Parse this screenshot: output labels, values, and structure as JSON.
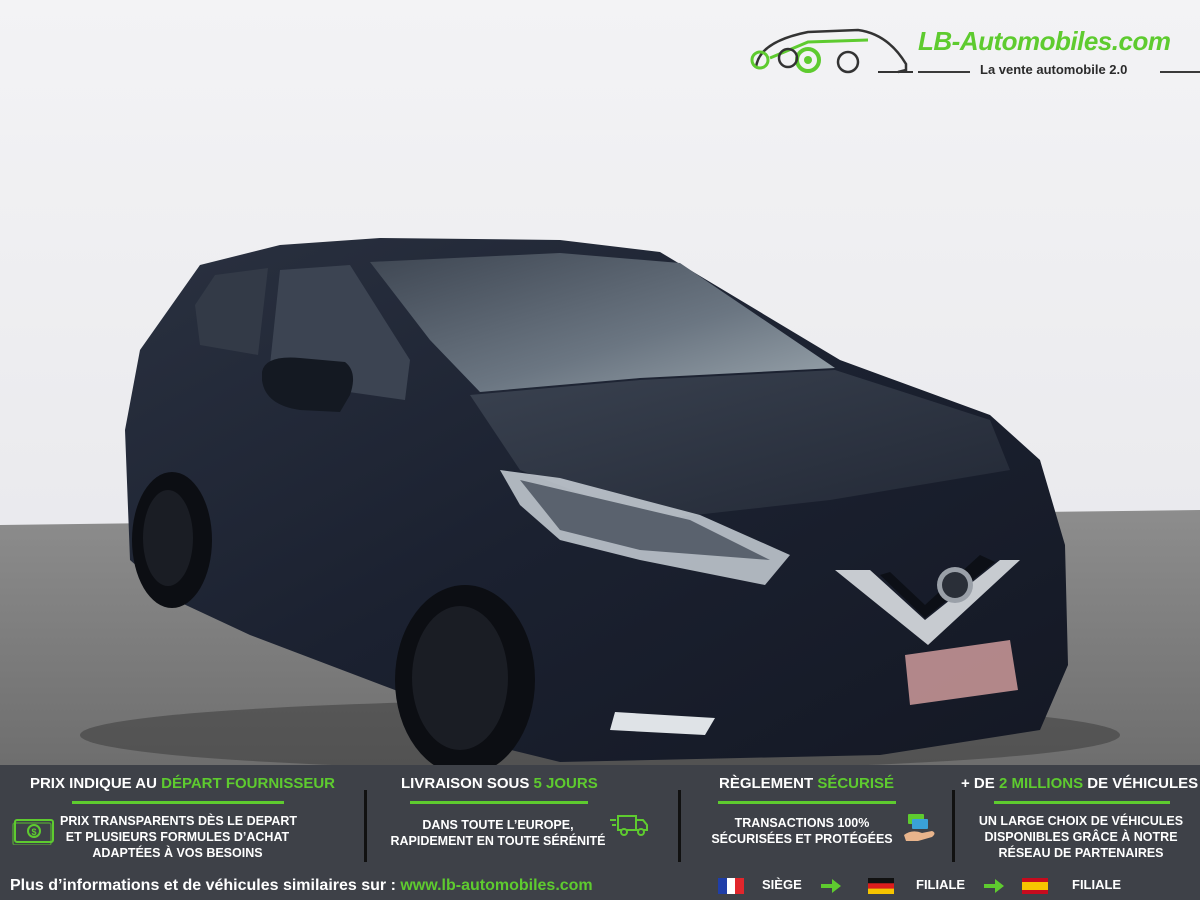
{
  "logo": {
    "name": "LB-Automobiles.com",
    "tagline": "La vente automobile 2.0"
  },
  "photo": {
    "subject": "car-photo"
  },
  "features": [
    {
      "title_plain": "PRIX INDIQUE AU ",
      "title_accent": "DÉPART FOURNISSEUR",
      "title_tail": "",
      "lines": [
        "PRIX TRANSPARENTS DÈS LE DEPART",
        "ET PLUSIEURS FORMULES D’ACHAT",
        "ADAPTÉES À VOS BESOINS"
      ],
      "icon": "money-icon"
    },
    {
      "title_plain": "LIVRAISON SOUS ",
      "title_accent": "5 JOURS",
      "title_tail": "",
      "lines": [
        "DANS TOUTE L’EUROPE,",
        "RAPIDEMENT EN TOUTE SÉRÉNITÉ"
      ],
      "icon": "delivery-truck-icon"
    },
    {
      "title_plain": "RÈGLEMENT ",
      "title_accent": "SÉCURISÉ",
      "title_tail": "",
      "lines": [
        "TRANSACTIONS 100%",
        "SÉCURISÉES ET PROTÉGÉES"
      ],
      "icon": "payment-hand-icon"
    },
    {
      "title_plain": "+ DE ",
      "title_accent": "2 MILLIONS",
      "title_tail": " DE VÉHICULES",
      "lines": [
        "UN LARGE CHOIX DE VÉHICULES",
        "DISPONIBLES GRÂCE À NOTRE",
        "RÉSEAU DE PARTENAIRES"
      ],
      "icon": ""
    }
  ],
  "footer": {
    "text": "Plus d’informations et de véhicules similaires sur : ",
    "url": "www.lb-automobiles.com",
    "locations": [
      {
        "label": "SIÈGE",
        "flag": "france-flag-icon"
      },
      {
        "label": "FILIALE",
        "flag": "germany-flag-icon"
      },
      {
        "label": "FILIALE",
        "flag": "spain-flag-icon"
      }
    ]
  },
  "colors": {
    "accent": "#5ecb2f",
    "banner": "#3e4148",
    "car_body": "#1d2432"
  }
}
